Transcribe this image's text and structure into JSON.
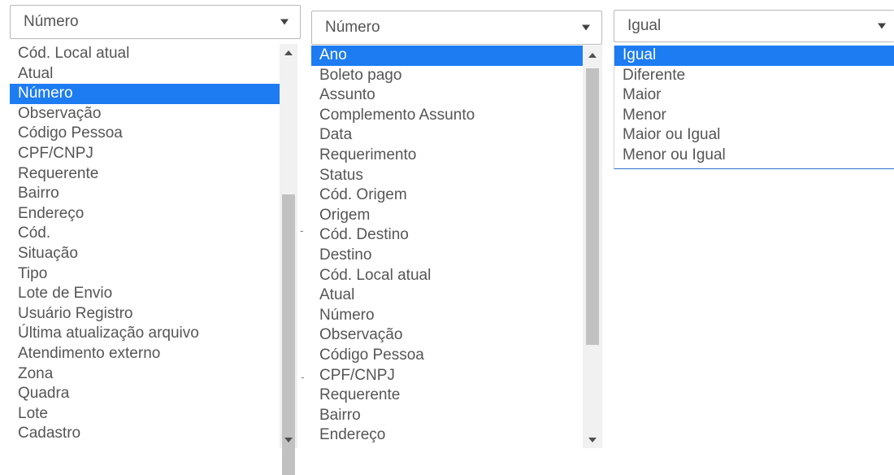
{
  "dropdown1": {
    "value": "Número",
    "options": [
      "Cód. Local atual",
      "Atual",
      "Número",
      "Observação",
      "Código Pessoa",
      "CPF/CNPJ",
      "Requerente",
      "Bairro",
      "Endereço",
      "Cód.",
      "Situação",
      "Tipo",
      "Lote de Envio",
      "Usuário Registro",
      "Última atualização arquivo",
      "Atendimento externo",
      "Zona",
      "Quadra",
      "Lote",
      "Cadastro"
    ],
    "selected_index": 2
  },
  "dropdown2": {
    "value": "Número",
    "options": [
      "Ano",
      "Boleto pago",
      "Assunto",
      "Complemento Assunto",
      "Data",
      "Requerimento",
      "Status",
      "Cód. Origem",
      "Origem",
      "Cód. Destino",
      "Destino",
      "Cód. Local atual",
      "Atual",
      "Número",
      "Observação",
      "Código Pessoa",
      "CPF/CNPJ",
      "Requerente",
      "Bairro",
      "Endereço"
    ],
    "selected_index": 0
  },
  "dropdown3": {
    "value": "Igual",
    "options": [
      "Igual",
      "Diferente",
      "Maior",
      "Menor",
      "Maior ou Igual",
      "Menor ou Igual"
    ],
    "selected_index": 0
  },
  "colors": {
    "selected_bg": "#1d7cf2",
    "selected_text": "#ffffff",
    "text": "#555555"
  },
  "icons": [
    "chevron-down-icon",
    "scroll-up-arrow-icon",
    "scroll-down-arrow-icon"
  ]
}
